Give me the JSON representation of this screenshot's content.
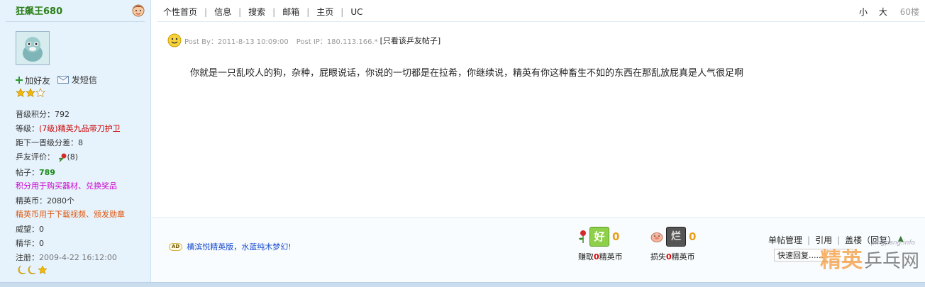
{
  "user": {
    "name": "狂飙王680",
    "add_friend": "加好友",
    "send_message": "发短信",
    "stats": {
      "promo_points": "晋级积分：792",
      "level_label": "等级：",
      "level_value": "(7级)精英九品带刀护卫",
      "next_level": "距下一晋级分差：8",
      "rating_label": "乒友评价：",
      "rating_count": "(8)",
      "posts_label": "帖子：",
      "posts_value": "789",
      "points_note": "积分用于购买器材、兑换奖品",
      "coins": "精英币：2080个",
      "coins_note": "精英币用于下载视频、颁发勋章",
      "prestige": "威望：0",
      "essence": "精华：0",
      "register_label": "注册：",
      "register_value": "2009-4-22 16:12:00"
    }
  },
  "nav": {
    "items": [
      "个性首页",
      "信息",
      "搜索",
      "邮箱",
      "主页",
      "UC"
    ],
    "font_small": "小",
    "font_large": "大",
    "floor": "60楼"
  },
  "post": {
    "by_label": "Post By：2011-8-13 10:09:00",
    "ip_label": "Post IP：180.113.166.*",
    "only_link": "[只看该乒友帖子]",
    "body": "你就是一只乱咬人的狗，杂种，屁眼说话，你说的一切都是在拉希，你继续说，精英有你这种畜生不如的东西在那乱放屁真是人气很足啊"
  },
  "footer": {
    "ad_badge": "AD",
    "ad_text": "横滨悦精英版，水蓝纯木梦幻!",
    "earn_icon_text": "好",
    "earn_count": "0",
    "earn_label_pre": "赚取",
    "earn_label_num": "0",
    "earn_label_post": "精英币",
    "lose_icon_text": "烂",
    "lose_count": "0",
    "lose_label_pre": "损失",
    "lose_label_num": "0",
    "lose_label_post": "精英币",
    "manage_links": [
      "单帖管理",
      "引用",
      "盖楼（回复）"
    ],
    "quick_reply_value": "快速回复......",
    "watermark_url": "pingpang.info",
    "watermark_big": "精英",
    "watermark_small": "乒乓网"
  },
  "colors": {
    "sidebar_bg": "#e6f3fc",
    "username": "#2a7f18",
    "level": "#cc0000",
    "posts": "#1a8a1a",
    "points_note": "#cc00cc",
    "coins_note": "#e0550b",
    "coin_count": "#e9a018"
  }
}
